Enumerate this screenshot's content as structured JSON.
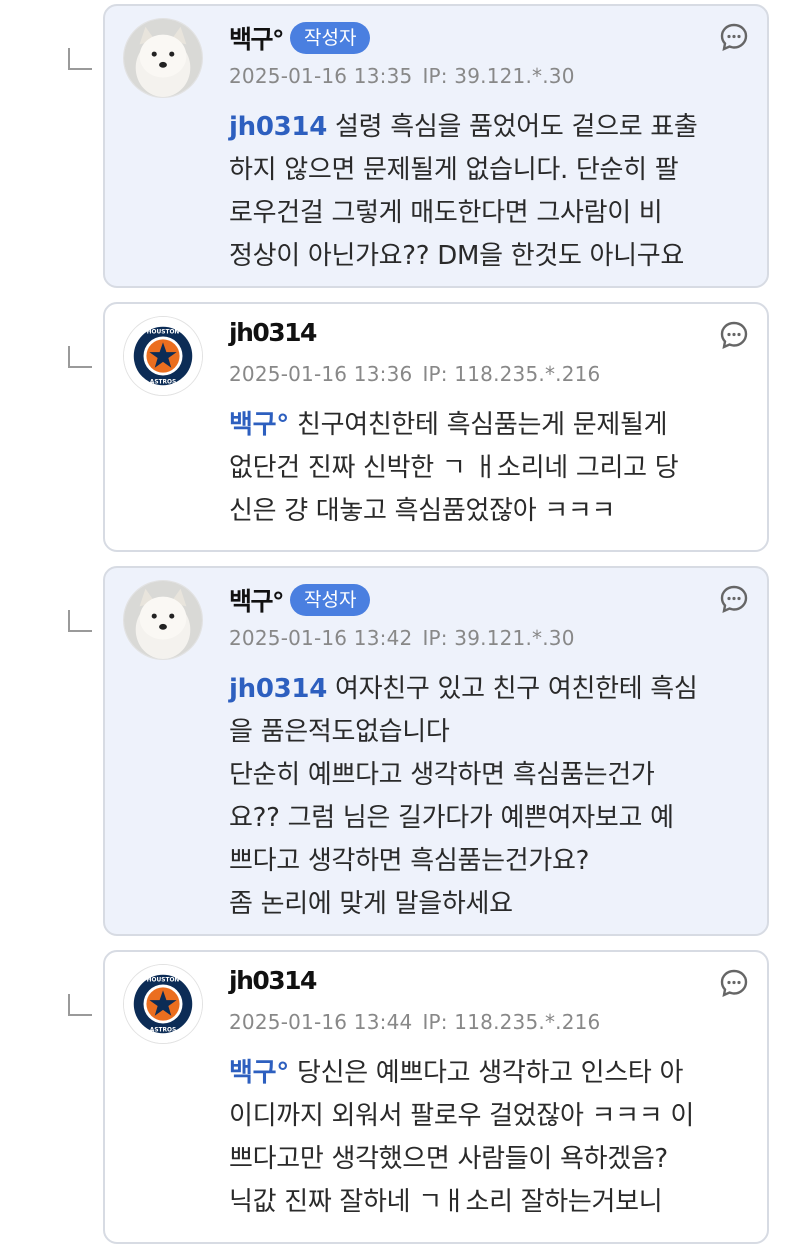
{
  "colors": {
    "author_bg": "#eef2fb",
    "badge": "#4a7fe0",
    "mention": "#2d5fbf"
  },
  "comments": [
    {
      "nickname": "백구°",
      "badge": "작성자",
      "timestamp": "2025-01-16 13:35",
      "ip": "IP: 39.121.*.30",
      "mention": "jh0314",
      "lines": [
        "설령 흑심을 품었어도 겉으로 표출",
        "하지 않으면 문제될게 없습니다. 단순히 팔",
        "로우건걸 그렇게 매도한다면 그사람이 비",
        "정상이 아닌가요?? DM을 한것도 아니구요"
      ],
      "avatar": "dog-avatar"
    },
    {
      "nickname": "jh0314",
      "timestamp": "2025-01-16 13:36",
      "ip": "IP: 118.235.*.216",
      "mention": "백구°",
      "lines": [
        "친구여친한테 흑심품는게 문제될게",
        "없단건 진짜 신박한 ㄱ ㅐ소리네 그리고 당",
        "신은 걍 대놓고 흑심품었잖아 ㅋㅋㅋ"
      ],
      "avatar": "astros-logo-avatar"
    },
    {
      "nickname": "백구°",
      "badge": "작성자",
      "timestamp": "2025-01-16 13:42",
      "ip": "IP: 39.121.*.30",
      "mention": "jh0314",
      "lines": [
        "여자친구 있고 친구 여친한테 흑심",
        "을 품은적도없습니다",
        "단순히 예쁘다고 생각하면 흑심품는건가",
        "요?? 그럼 님은 길가다가 예쁜여자보고 예",
        "쁘다고 생각하면 흑심품는건가요?",
        "좀 논리에 맞게 말을하세요"
      ],
      "avatar": "dog-avatar"
    },
    {
      "nickname": "jh0314",
      "timestamp": "2025-01-16 13:44",
      "ip": "IP: 118.235.*.216",
      "mention": "백구°",
      "lines": [
        "당신은 예쁘다고 생각하고 인스타 아",
        "이디까지 외워서 팔로우 걸었잖아 ㅋㅋㅋ 이",
        "쁘다고만 생각했으면 사람들이 욕하겠음?",
        "닉값 진짜 잘하네 ㄱㅐ소리 잘하는거보니"
      ],
      "avatar": "astros-logo-avatar"
    }
  ]
}
